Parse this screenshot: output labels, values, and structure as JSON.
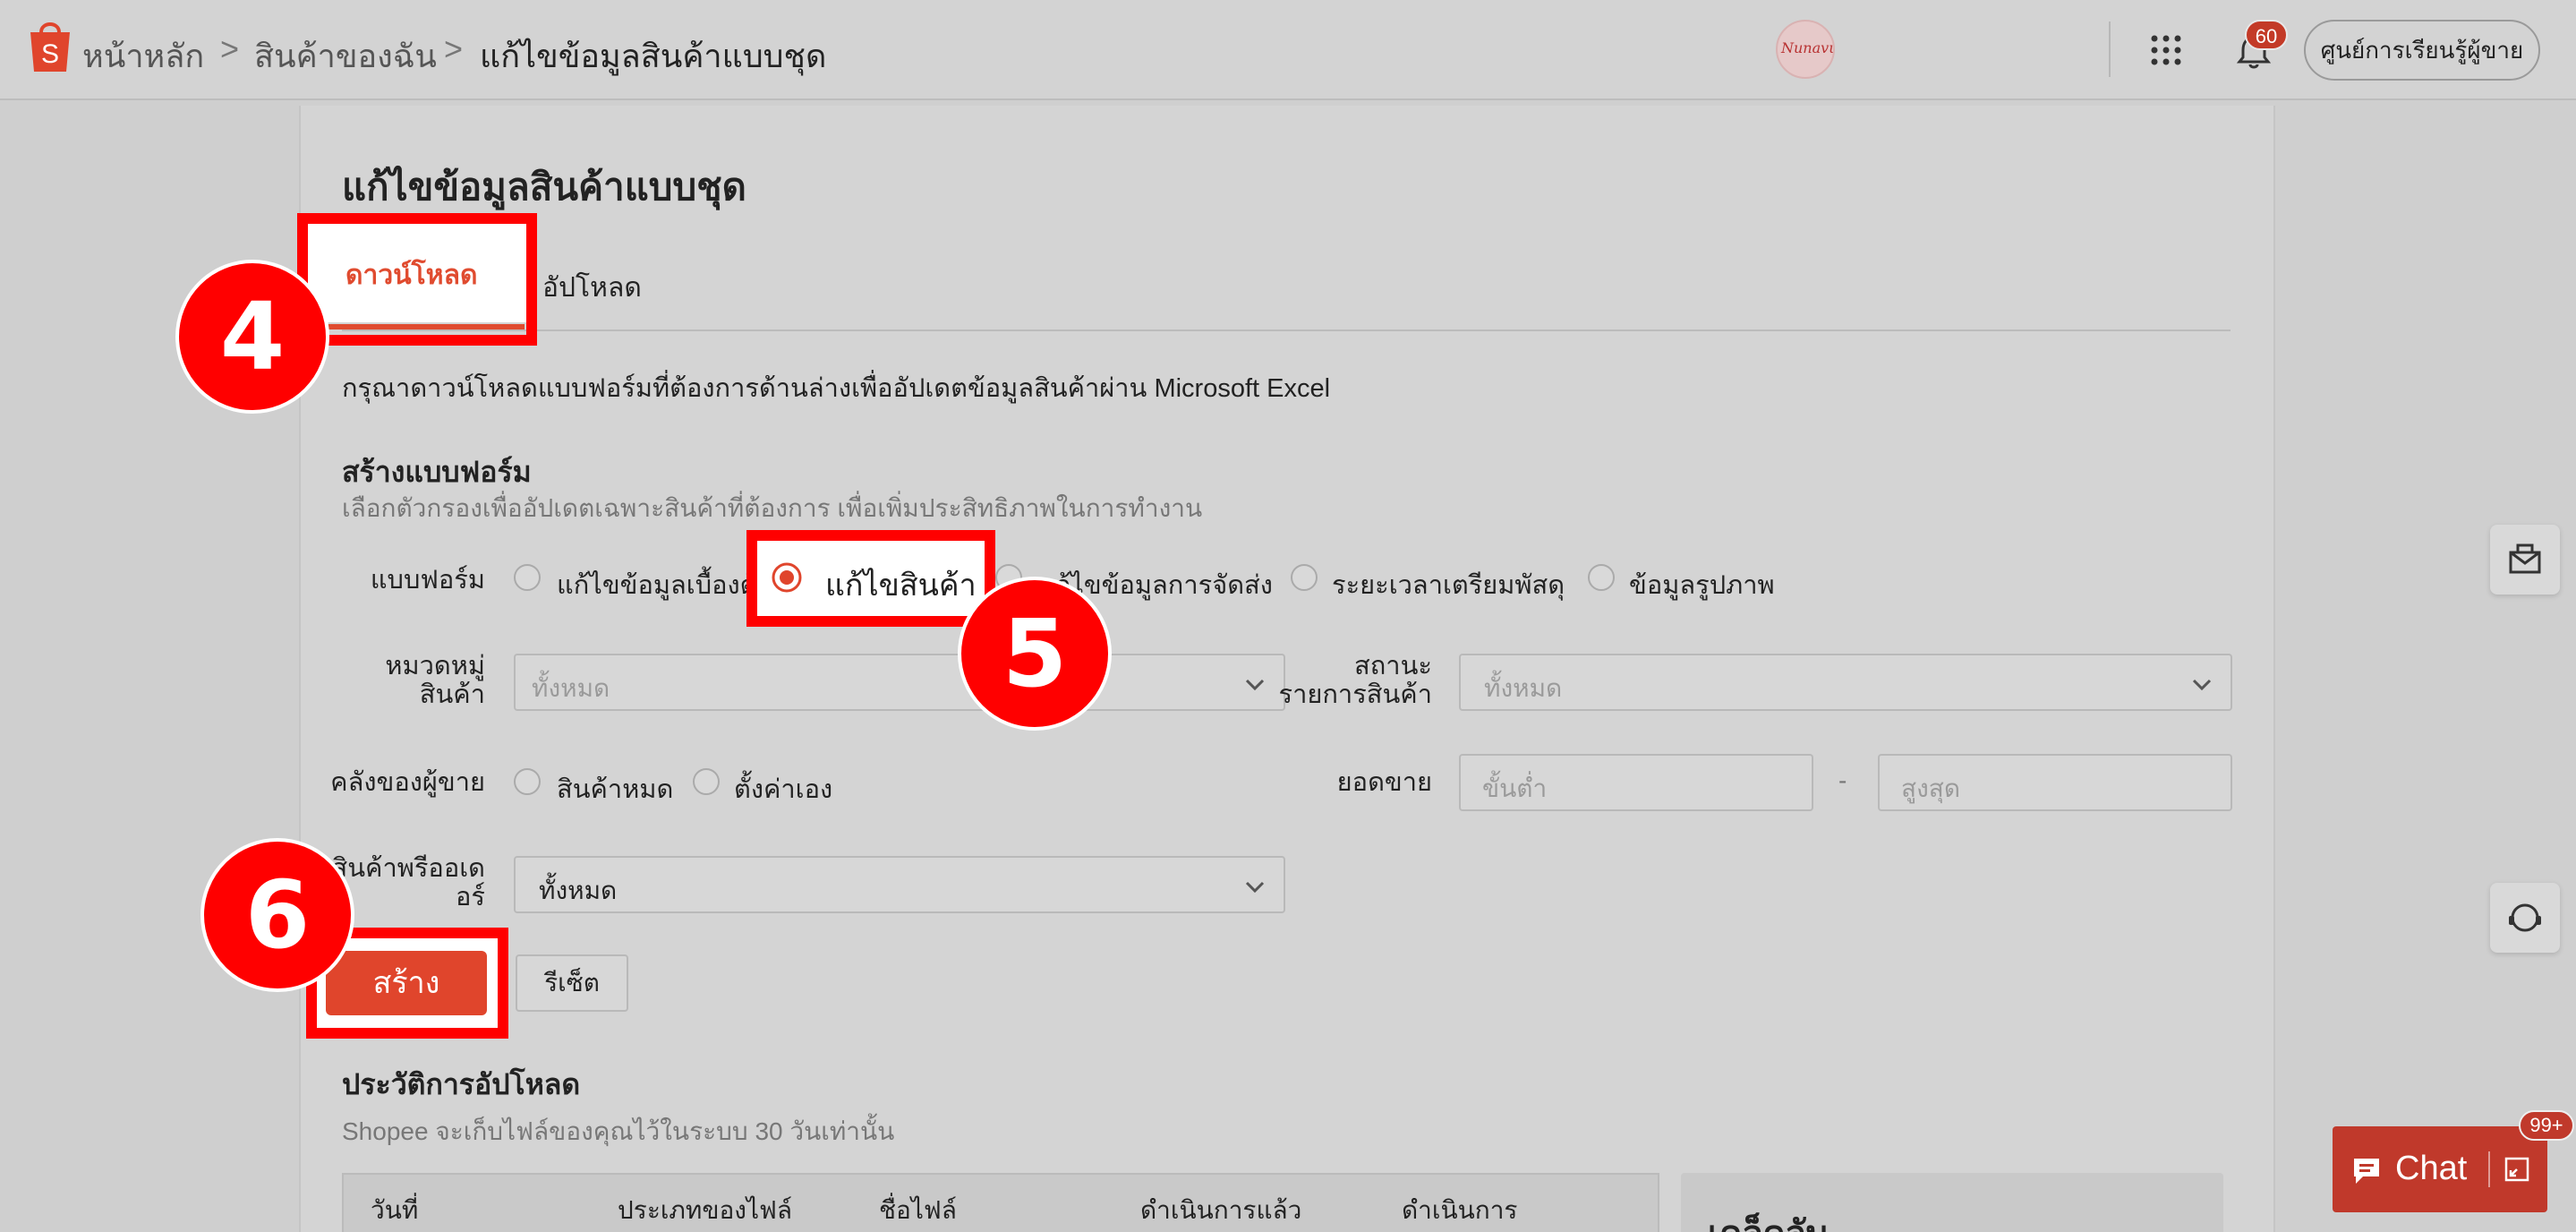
{
  "header": {
    "breadcrumb": [
      "หน้าหลัก",
      "สินค้าของฉัน",
      "แก้ไขข้อมูลสินค้าแบบชุด"
    ],
    "avatar_text": "Nunavut",
    "notif_count": "60",
    "learn_button": "ศูนย์การเรียนรู้ผู้ขาย"
  },
  "page": {
    "title": "แก้ไขข้อมูลสินค้าแบบชุด",
    "tabs": [
      {
        "label": "ดาวน์โหลด",
        "active": true
      },
      {
        "label": "อัปโหลด",
        "active": false
      }
    ],
    "intro": "กรุณาดาวน์โหลดแบบฟอร์มที่ต้องการด้านล่างเพื่ออัปเดตข้อมูลสินค้าผ่าน Microsoft Excel"
  },
  "form": {
    "title": "สร้างแบบฟอร์ม",
    "subtitle": "เลือกตัวกรองเพื่ออัปเดตเฉพาะสินค้าที่ต้องการ เพื่อเพิ่มประสิทธิภาพในการทำงาน",
    "template_label": "แบบฟอร์ม",
    "template_options": [
      {
        "label": "แก้ไขข้อมูลเบื้องต้น",
        "selected": false
      },
      {
        "label": "แก้ไขสินค้า",
        "selected": true
      },
      {
        "label": "แก้ไขข้อมูลการจัดส่ง",
        "selected": false
      },
      {
        "label": "ระยะเวลาเตรียมพัสดุ",
        "selected": false
      },
      {
        "label": "ข้อมูลรูปภาพ",
        "selected": false
      }
    ],
    "category_label_1": "หมวดหมู่",
    "category_label_2": "สินค้า",
    "category_placeholder": "ทั้งหมด",
    "status_label_1": "สถานะ",
    "status_label_2": "รายการสินค้า",
    "status_placeholder": "ทั้งหมด",
    "stock_label": "คลังของผู้ขาย",
    "stock_options": [
      {
        "label": "สินค้าหมด",
        "selected": false
      },
      {
        "label": "ตั้งค่าเอง",
        "selected": false
      }
    ],
    "sales_label": "ยอดขาย",
    "sales_min_placeholder": "ขั้นต่ำ",
    "sales_sep": "-",
    "sales_max_placeholder": "สูงสุด",
    "preorder_label_1": "สินค้าพรีออเด",
    "preorder_label_2": "อร์",
    "preorder_value": "ทั้งหมด",
    "create_button": "สร้าง",
    "reset_button": "รีเซ็ต"
  },
  "history": {
    "title": "ประวัติการอัปโหลด",
    "subtitle": "Shopee จะเก็บไฟล์ของคุณไว้ในระบบ 30 วันเท่านั้น",
    "columns": [
      "วันที่",
      "ประเภทของไฟล์",
      "ชื่อไฟล์",
      "ดำเนินการแล้ว",
      "ดำเนินการ"
    ]
  },
  "tips": {
    "title": "เคล็ดลับ"
  },
  "chat": {
    "label": "Chat",
    "badge": "99+"
  },
  "annotations": {
    "step4": "4",
    "step5": "5",
    "step6": "6"
  },
  "colors": {
    "accent": "#e0452c",
    "highlight": "#ff0000"
  }
}
